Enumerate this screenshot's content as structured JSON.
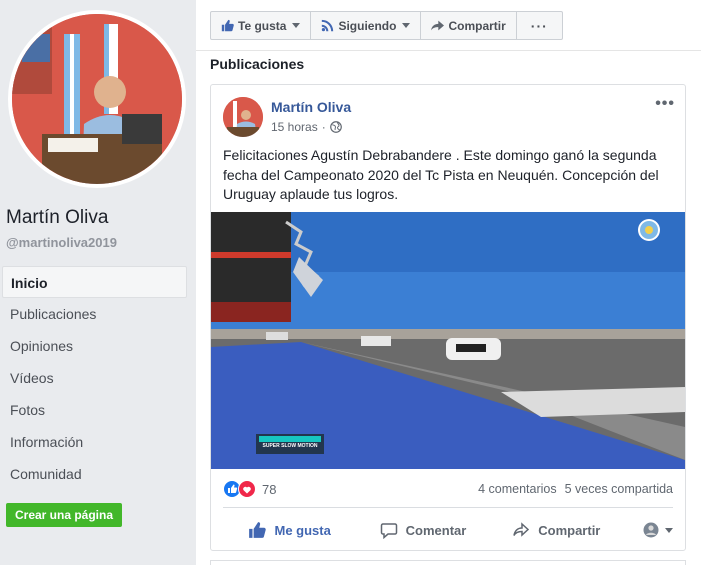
{
  "page": {
    "name": "Martín Oliva",
    "handle": "@martinoliva2019"
  },
  "nav": {
    "items": [
      {
        "label": "Inicio",
        "active": true
      },
      {
        "label": "Publicaciones"
      },
      {
        "label": "Opiniones"
      },
      {
        "label": "Vídeos"
      },
      {
        "label": "Fotos"
      },
      {
        "label": "Información"
      },
      {
        "label": "Comunidad"
      }
    ],
    "create_page": "Crear una página"
  },
  "actionbar": {
    "like": "Te gusta",
    "follow": "Siguiendo",
    "share": "Compartir",
    "more": "···"
  },
  "section_title": "Publicaciones",
  "post": {
    "author": "Martín Oliva",
    "time": "15 horas",
    "text": "Felicitaciones Agustín Debrabandere . Este domingo ganó la segunda fecha del Campeonato 2020 del Tc Pista en Neuquén. Concepción del Uruguay aplaude tus logros.",
    "image_overlay": "SUPER SLOW MOTION",
    "reactions_count": "78",
    "comments": "4 comentarios",
    "shares": "5 veces compartida",
    "actions": {
      "like": "Me gusta",
      "comment": "Comentar",
      "share": "Compartir"
    }
  },
  "colors": {
    "link_blue": "#365899",
    "like_blue": "#4267b2",
    "green_button": "#42b72a",
    "background": "#e9ebee"
  },
  "icons": [
    "thumbs-up-icon",
    "rss-icon",
    "share-arrow-icon",
    "globe-icon",
    "love-reaction-icon",
    "comment-icon",
    "chevron-down-icon"
  ]
}
